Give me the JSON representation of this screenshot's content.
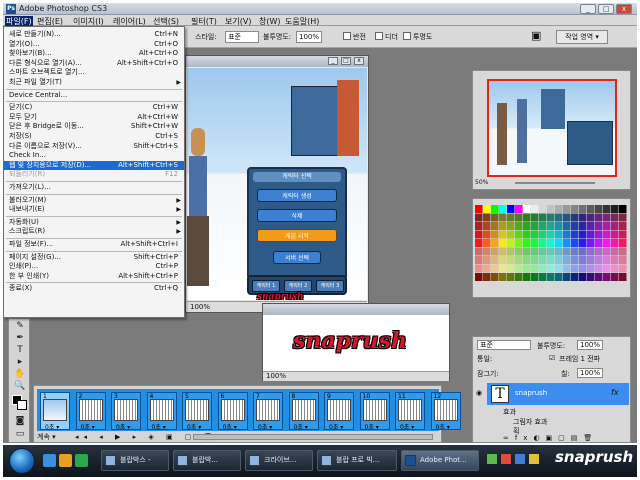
{
  "window": {
    "title": "Adobe Photoshop CS3",
    "app_icon": "Ps"
  },
  "menubar": [
    {
      "label": "파일(F)",
      "active": true
    },
    {
      "label": "편집(E)"
    },
    {
      "label": "이미지(I)"
    },
    {
      "label": "레이어(L)"
    },
    {
      "label": "선택(S)"
    },
    {
      "label": "필터(T)"
    },
    {
      "label": "보기(V)"
    },
    {
      "label": "창(W)"
    },
    {
      "label": "도움말(H)"
    }
  ],
  "options": {
    "style_label": "스타일:",
    "style_value": "표준",
    "opacity_label": "불투명도:",
    "opacity_value": "100%",
    "cb1": "반전",
    "cb2": "디더",
    "cb3": "투명도",
    "workspace_label": "작업 영역 ▾"
  },
  "filemenu": [
    {
      "label": "새로 만들기(N)...",
      "shortcut": "Ctrl+N"
    },
    {
      "label": "열기(O)...",
      "shortcut": "Ctrl+O"
    },
    {
      "label": "찾아보기(B)...",
      "shortcut": "Alt+Ctrl+O"
    },
    {
      "label": "다른 형식으로 열기(A)...",
      "shortcut": "Alt+Shift+Ctrl+O"
    },
    {
      "label": "스마트 오브젝트로 열기...",
      "shortcut": ""
    },
    {
      "label": "최근 파일 열기(T)",
      "shortcut": "",
      "submenu": true
    },
    {
      "sep": true
    },
    {
      "label": "Device Central...",
      "shortcut": ""
    },
    {
      "sep": true
    },
    {
      "label": "닫기(C)",
      "shortcut": "Ctrl+W"
    },
    {
      "label": "모두 닫기",
      "shortcut": "Alt+Ctrl+W"
    },
    {
      "label": "닫은 후 Bridge로 이동...",
      "shortcut": "Shift+Ctrl+W"
    },
    {
      "label": "저장(S)",
      "shortcut": "Ctrl+S"
    },
    {
      "label": "다른 이름으로 저장(V)...",
      "shortcut": "Shift+Ctrl+S"
    },
    {
      "label": "Check In...",
      "shortcut": ""
    },
    {
      "label": "웹 및 장치용으로 저장(D)...",
      "shortcut": "Alt+Shift+Ctrl+S",
      "highlight": true
    },
    {
      "label": "되돌리기(R)",
      "shortcut": "F12",
      "disabled": true
    },
    {
      "sep": true
    },
    {
      "label": "가져오기(L)...",
      "shortcut": ""
    },
    {
      "sep": true
    },
    {
      "label": "불러오기(M)",
      "shortcut": "",
      "submenu": true
    },
    {
      "label": "내보내기(E)",
      "shortcut": "",
      "submenu": true
    },
    {
      "sep": true
    },
    {
      "label": "자동화(U)",
      "shortcut": "",
      "submenu": true
    },
    {
      "label": "스크립트(R)",
      "shortcut": "",
      "submenu": true
    },
    {
      "sep": true
    },
    {
      "label": "파일 정보(F)...",
      "shortcut": "Alt+Shift+Ctrl+I"
    },
    {
      "sep": true
    },
    {
      "label": "페이지 설정(G)...",
      "shortcut": "Shift+Ctrl+P"
    },
    {
      "label": "인쇄(P)...",
      "shortcut": "Ctrl+P"
    },
    {
      "label": "한 부 인쇄(Y)",
      "shortcut": "Alt+Shift+Ctrl+P"
    },
    {
      "sep": true
    },
    {
      "label": "종료(X)",
      "shortcut": "Ctrl+Q"
    }
  ],
  "game_dialog": {
    "title": "캐릭터 선택",
    "buttons": [
      "캐릭터 생성",
      "삭제",
      "게임 시작",
      "서버 선택"
    ],
    "bottom_buttons": [
      "캐릭터 1",
      "캐릭터 2",
      "캐릭터 3"
    ],
    "watermark": "snaprush"
  },
  "docwin_zoom": "100%",
  "navigator_zoom": "50%",
  "text_preview": {
    "text": "snaprush",
    "zoom": "100%"
  },
  "layers": {
    "blend_mode": "표준",
    "opacity_label": "불투명도:",
    "opacity_value": "100%",
    "unify_label": "통일:",
    "propagate_label": "프레임 1 전파",
    "lock_label": "잠그기:",
    "fill_label": "칠:",
    "fill_value": "100%",
    "layer_name": "snaprush",
    "effects_label": "효과",
    "effect_item": "그림자 효과",
    "stroke_item": "획"
  },
  "animation": {
    "frames": [
      {
        "num": "1",
        "time": "0초 ▾"
      },
      {
        "num": "2",
        "time": "0초 ▾"
      },
      {
        "num": "3",
        "time": "0초 ▾"
      },
      {
        "num": "4",
        "time": "0초 ▾"
      },
      {
        "num": "5",
        "time": "0초 ▾"
      },
      {
        "num": "6",
        "time": "0초 ▾"
      },
      {
        "num": "7",
        "time": "0초 ▾"
      },
      {
        "num": "8",
        "time": "0초 ▾"
      },
      {
        "num": "9",
        "time": "0초 ▾"
      },
      {
        "num": "10",
        "time": "0초 ▾"
      },
      {
        "num": "11",
        "time": "0초 ▾"
      },
      {
        "num": "12",
        "time": "0초 ▾"
      }
    ],
    "loop_label": "계속 ▾"
  },
  "taskbar": {
    "buttons": [
      {
        "label": "블랍박스 -"
      },
      {
        "label": "블랍박..."
      },
      {
        "label": "크라이브..."
      },
      {
        "label": "블랍 프로 빅..."
      },
      {
        "label": "Adobe Phot...",
        "active": true
      }
    ],
    "watermark": "snaprush"
  },
  "colors": {
    "workspace": "#7b7b7b",
    "menu_highlight": "#1c6ad2",
    "brand_red": "#d6142a",
    "timeline_blue": "#1f8fe3"
  }
}
